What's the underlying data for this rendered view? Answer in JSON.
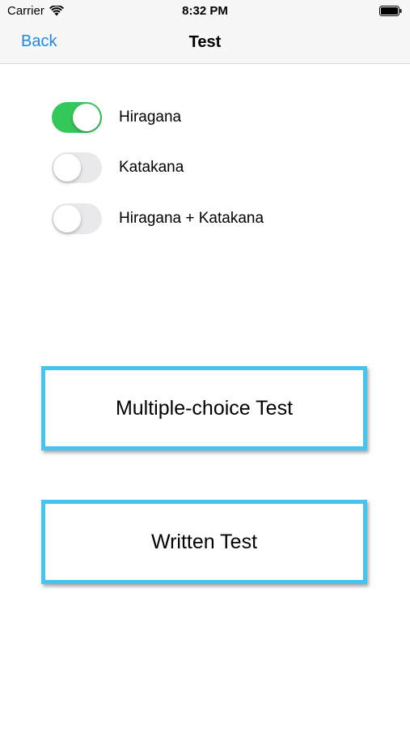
{
  "status_bar": {
    "carrier": "Carrier",
    "time": "8:32 PM",
    "icons": [
      "wifi-icon",
      "battery-icon"
    ]
  },
  "nav": {
    "back_label": "Back",
    "title": "Test",
    "accent_color": "#1e88e5"
  },
  "toggles": [
    {
      "label": "Hiragana",
      "on": true
    },
    {
      "label": "Katakana",
      "on": false
    },
    {
      "label": "Hiragana + Katakana",
      "on": false
    }
  ],
  "buttons": {
    "multiple_choice": "Multiple-choice Test",
    "written": "Written Test",
    "border_color": "#45c4f0"
  },
  "colors": {
    "switch_on": "#34c759",
    "switch_off": "#e9e9eb"
  }
}
